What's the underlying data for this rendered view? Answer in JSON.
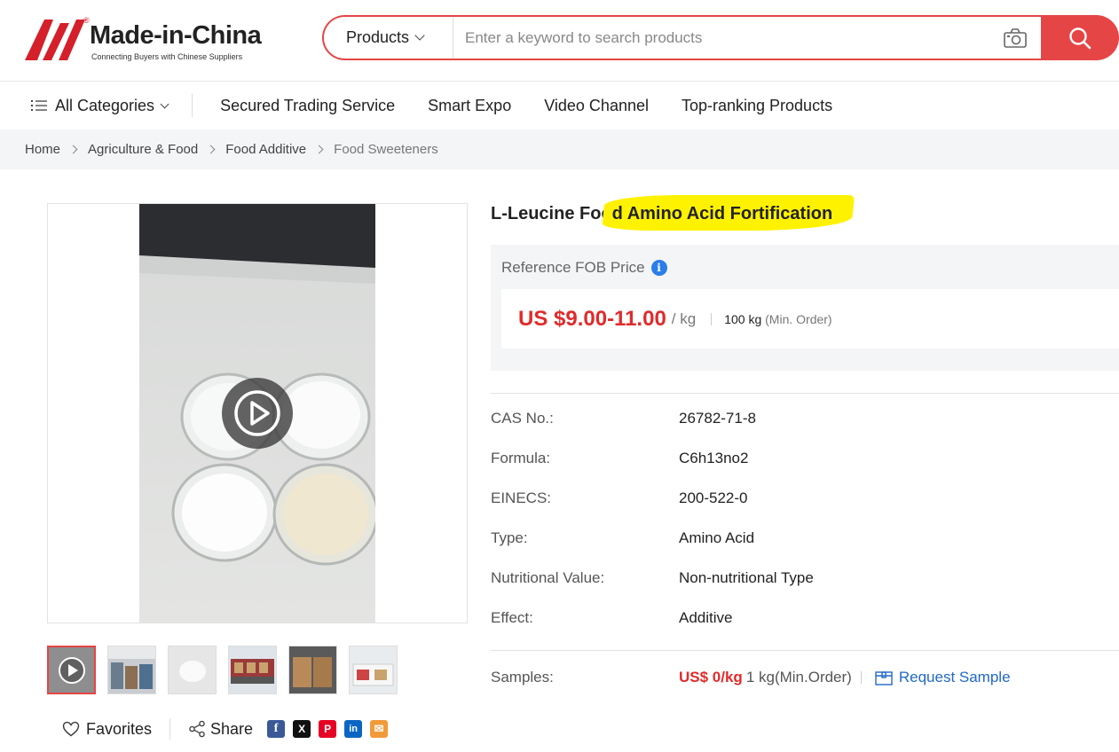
{
  "header": {
    "brand": "Made-in-China",
    "reg_mark": "®",
    "tagline": "Connecting Buyers with Chinese Suppliers",
    "search_type": "Products",
    "search_placeholder": "Enter a keyword to search products"
  },
  "nav": {
    "all_categories": "All Categories",
    "items": [
      "Secured Trading Service",
      "Smart Expo",
      "Video Channel",
      "Top-ranking Products"
    ]
  },
  "breadcrumb": [
    "Home",
    "Agriculture & Food",
    "Food Additive",
    "Food Sweeteners"
  ],
  "product": {
    "title_plain": "L-Leucine Foo",
    "title_highlight": "d Amino Acid Fortification",
    "price_label": "Reference FOB Price",
    "info_glyph": "i",
    "price": "US $9.00-11.00",
    "unit": "/ kg",
    "moq_qty": "100 kg",
    "moq_note": "(Min. Order)",
    "attributes": [
      {
        "key": "CAS No.:",
        "value": "26782-71-8"
      },
      {
        "key": "Formula:",
        "value": "C6h13no2"
      },
      {
        "key": "EINECS:",
        "value": "200-522-0"
      },
      {
        "key": "Type:",
        "value": "Amino Acid"
      },
      {
        "key": "Nutritional Value:",
        "value": "Non-nutritional Type"
      },
      {
        "key": "Effect:",
        "value": "Additive"
      }
    ],
    "samples": {
      "label": "Samples:",
      "price": "US$ 0/kg",
      "qty": "1 kg(Min.Order)",
      "request": "Request Sample"
    }
  },
  "actions": {
    "favorites": "Favorites",
    "share": "Share"
  },
  "social_icons": [
    {
      "name": "facebook-icon",
      "glyph": "f",
      "color": "#3b5998"
    },
    {
      "name": "x-icon",
      "glyph": "X",
      "color": "#111111"
    },
    {
      "name": "pinterest-icon",
      "glyph": "P",
      "color": "#e60023"
    },
    {
      "name": "linkedin-icon",
      "glyph": "in",
      "color": "#0a66c2"
    },
    {
      "name": "email-icon",
      "glyph": "✉",
      "color": "#f29a38"
    }
  ],
  "colors": {
    "accent": "#e64545",
    "price": "#e02b2b",
    "link": "#2168c7",
    "highlight": "#fff200"
  }
}
